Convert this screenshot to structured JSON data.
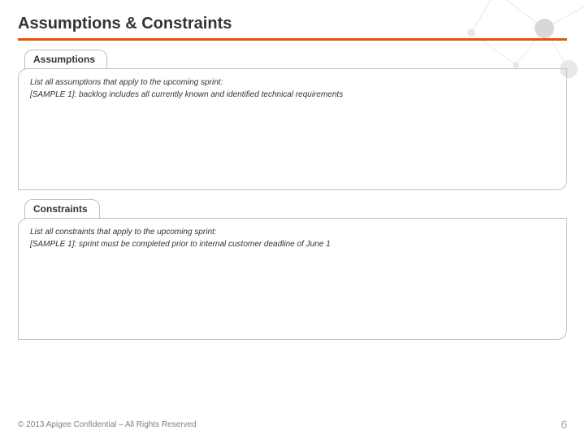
{
  "title": "Assumptions & Constraints",
  "sections": [
    {
      "label": "Assumptions",
      "line1": "List all assumptions that apply to the upcoming sprint:",
      "line2": "[SAMPLE 1]: backlog includes all currently known and identified technical requirements"
    },
    {
      "label": "Constraints",
      "line1": "List all constraints that apply to the upcoming sprint:",
      "line2": "[SAMPLE 1]: sprint must be completed prior to internal customer deadline of June 1"
    }
  ],
  "footer": {
    "copyright": "© 2013 Apigee Confidential – All Rights Reserved",
    "page": "6"
  }
}
